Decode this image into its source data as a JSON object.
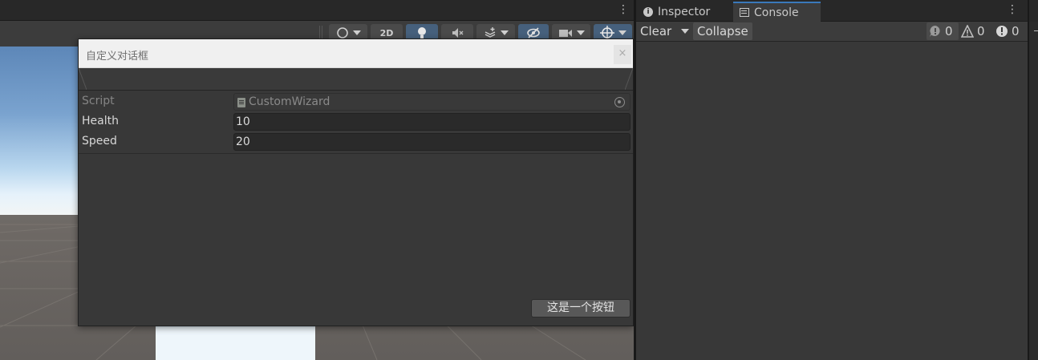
{
  "scene": {
    "toolbar": {
      "btn_2d_label": "2D"
    }
  },
  "dialog": {
    "title": "自定义对话框",
    "close_label": "×",
    "properties": [
      {
        "label": "Script",
        "value": "CustomWizard"
      },
      {
        "label": "Health",
        "value": "10"
      },
      {
        "label": "Speed",
        "value": "20"
      }
    ],
    "button_label": "这是一个按钮"
  },
  "right_panel": {
    "tabs": [
      {
        "label": "Inspector",
        "active": false
      },
      {
        "label": "Console",
        "active": true
      }
    ],
    "console": {
      "clear_label": "Clear",
      "collapse_label": "Collapse",
      "log_count": "0",
      "warning_count": "0",
      "error_count": "0"
    }
  },
  "icons": {
    "panel_menu": "kebab-menu-icon",
    "inspector_tab": "info-icon",
    "console_tab": "console-icon",
    "log": "log-info-icon",
    "warning": "warning-triangle-icon",
    "error": "error-icon",
    "script": "script-file-icon",
    "object_picker": "object-picker-icon"
  },
  "colors": {
    "accent_tab": "#3a79bb",
    "active_toolbar_button": "#46607c",
    "panel_bg": "#383838"
  }
}
